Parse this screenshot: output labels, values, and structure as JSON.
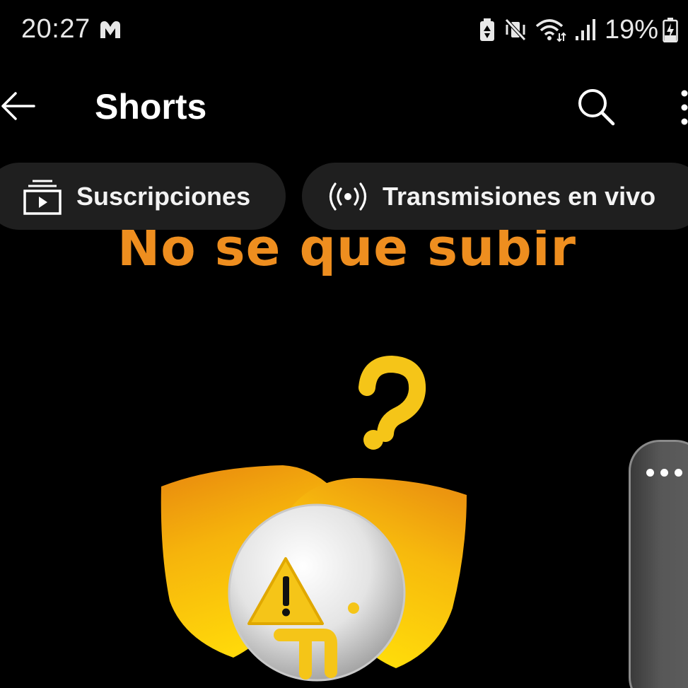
{
  "status_bar": {
    "time": "20:27",
    "app_icon": "malwarebytes-icon",
    "icons": [
      "battery-saver-icon",
      "vibrate-mute-icon",
      "wifi-icon",
      "signal-icon"
    ],
    "battery_percent": "19%",
    "charging_icon": "battery-charging-icon"
  },
  "header": {
    "title": "Shorts",
    "back_icon": "back-arrow-icon",
    "search_icon": "search-icon",
    "more_icon": "more-vert-icon"
  },
  "chips": [
    {
      "label": "Suscripciones",
      "icon": "subscriptions-icon"
    },
    {
      "label": "Transmisiones en vivo",
      "icon": "live-broadcast-icon"
    }
  ],
  "video": {
    "caption": "No se que subir",
    "art_icons": [
      "question-mark-icon",
      "warning-icon"
    ]
  },
  "edge_panel": {
    "icon": "more-horiz-icon"
  },
  "colors": {
    "background": "#000000",
    "chip_background": "#1f1f1f",
    "caption": "#ee8e1f",
    "accent_yellow": "#f5c518"
  }
}
